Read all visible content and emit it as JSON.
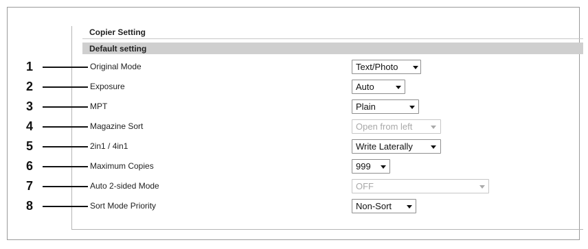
{
  "header": {
    "title": "Copier Setting",
    "section": "Default setting"
  },
  "rows": [
    {
      "number": "1",
      "label": "Original Mode",
      "value": "Text/Photo",
      "disabled": false
    },
    {
      "number": "2",
      "label": "Exposure",
      "value": "Auto",
      "disabled": false
    },
    {
      "number": "3",
      "label": "MPT",
      "value": "Plain",
      "disabled": false
    },
    {
      "number": "4",
      "label": "Magazine Sort",
      "value": "Open from left",
      "disabled": true
    },
    {
      "number": "5",
      "label": "2in1 / 4in1",
      "value": "Write Laterally",
      "disabled": false
    },
    {
      "number": "6",
      "label": "Maximum Copies",
      "value": "999",
      "disabled": false
    },
    {
      "number": "7",
      "label": "Auto 2-sided Mode",
      "value": "OFF",
      "disabled": true
    },
    {
      "number": "8",
      "label": "Sort Mode Priority",
      "value": "Non-Sort",
      "disabled": false
    }
  ],
  "icons": {
    "dropdown": "chevron-down-icon"
  },
  "colors": {
    "section_bar": "#cfcfcf",
    "disabled_text": "#a8a8a8"
  }
}
